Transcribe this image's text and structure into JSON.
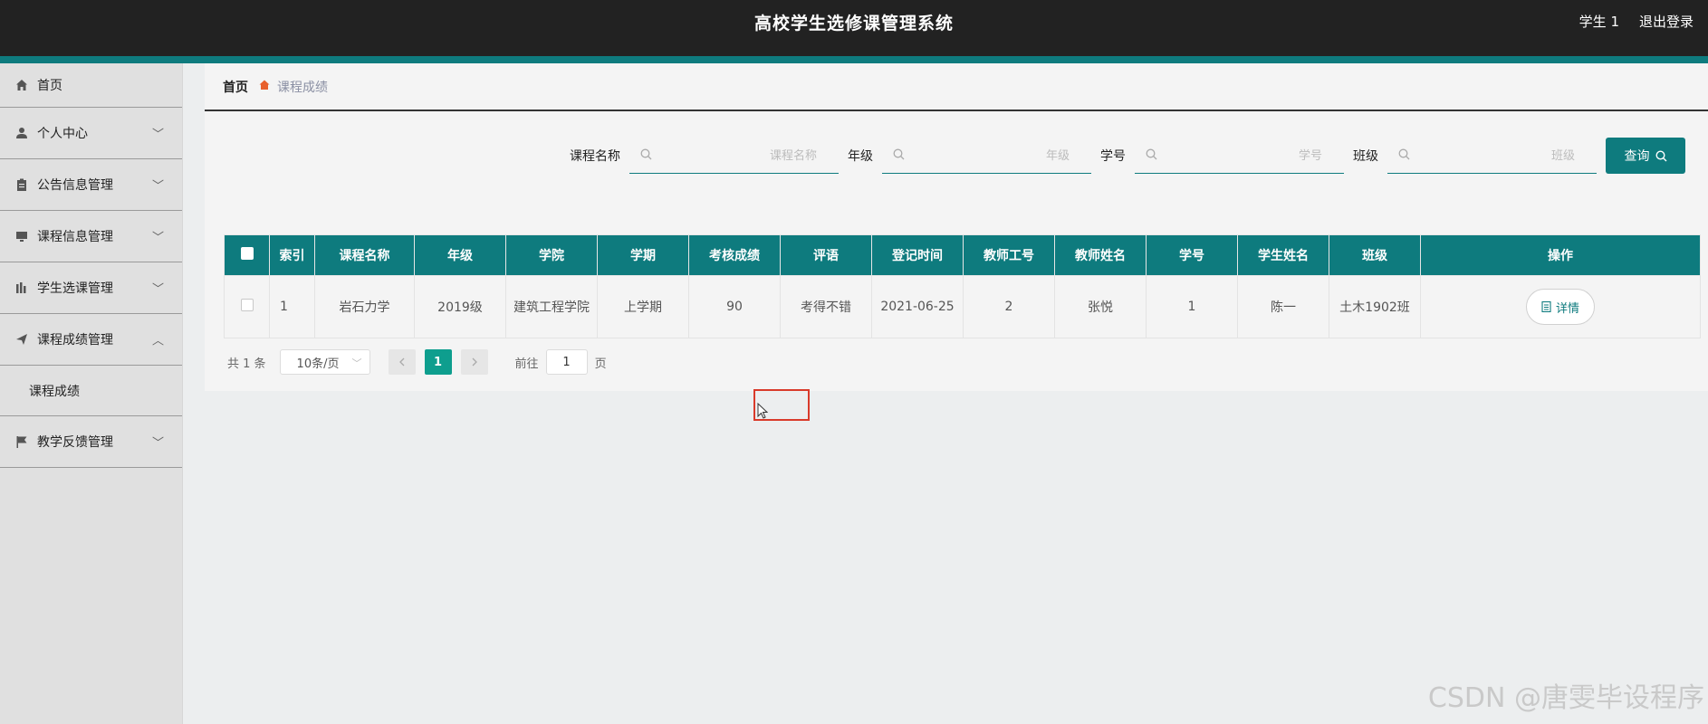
{
  "header": {
    "title": "高校学生选修课管理系统",
    "user": "学生 1",
    "logout": "退出登录"
  },
  "sidebar": {
    "items": [
      {
        "label": "首页",
        "icon": "home-icon"
      },
      {
        "label": "个人中心",
        "icon": "user-icon"
      },
      {
        "label": "公告信息管理",
        "icon": "clipboard-icon"
      },
      {
        "label": "课程信息管理",
        "icon": "monitor-icon"
      },
      {
        "label": "学生选课管理",
        "icon": "bar-chart-icon"
      },
      {
        "label": "课程成绩管理",
        "icon": "send-icon"
      },
      {
        "label": "课程成绩",
        "sub": true
      },
      {
        "label": "教学反馈管理",
        "icon": "flag-icon"
      }
    ]
  },
  "breadcrumb": {
    "home": "首页",
    "current": "课程成绩"
  },
  "search": {
    "course_label": "课程名称",
    "course_placeholder": "课程名称",
    "grade_label": "年级",
    "grade_placeholder": "年级",
    "student_no_label": "学号",
    "student_no_placeholder": "学号",
    "class_label": "班级",
    "class_placeholder": "班级",
    "query_button": "查询"
  },
  "table": {
    "columns": [
      "索引",
      "课程名称",
      "年级",
      "学院",
      "学期",
      "考核成绩",
      "评语",
      "登记时间",
      "教师工号",
      "教师姓名",
      "学号",
      "学生姓名",
      "班级",
      "操作"
    ],
    "rows": [
      {
        "index": "1",
        "course": "岩石力学",
        "grade": "2019级",
        "college": "建筑工程学院",
        "term": "上学期",
        "score": "90",
        "comment": "考得不错",
        "date": "2021-06-25",
        "teacher_no": "2",
        "teacher_name": "张悦",
        "student_no": "1",
        "student_name": "陈一",
        "class": "土木1902班",
        "action": "详情"
      }
    ]
  },
  "pagination": {
    "total": "共 1 条",
    "page_size": "10条/页",
    "current_page": "1",
    "goto_label": "前往",
    "goto_value": "1",
    "page_suffix": "页"
  },
  "watermark": "CSDN @唐雯毕设程序",
  "colors": {
    "header_bg": "#222222",
    "accent": "#0e7b7e",
    "active_page": "#0e9e8e",
    "breadcrumb_sep": "#e8602c"
  }
}
